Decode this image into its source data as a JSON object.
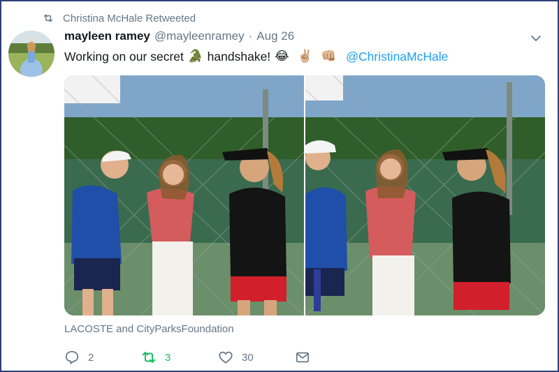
{
  "context": {
    "retweeted_by": "Christina McHale Retweeted"
  },
  "tweet": {
    "author_name": "mayleen ramey",
    "author_handle": "@mayleenramey",
    "separator": "·",
    "date": "Aug 26",
    "text_before": "Working on our secret",
    "text_after": "handshake!",
    "emojis": [
      "🐊",
      "😂",
      "✌🏼",
      "👊🏼"
    ],
    "mention": "@ChristinaMcHale",
    "media_credit": "LACOSTE and CityParksFoundation"
  },
  "actions": {
    "reply_count": "2",
    "retweet_count": "3",
    "like_count": "30"
  },
  "colors": {
    "accent": "#1da1f2",
    "retweet_active": "#17bf63",
    "muted": "#657786"
  },
  "icons": [
    "retweet-icon",
    "chevron-down-icon",
    "reply-icon",
    "like-icon",
    "direct-message-icon"
  ]
}
